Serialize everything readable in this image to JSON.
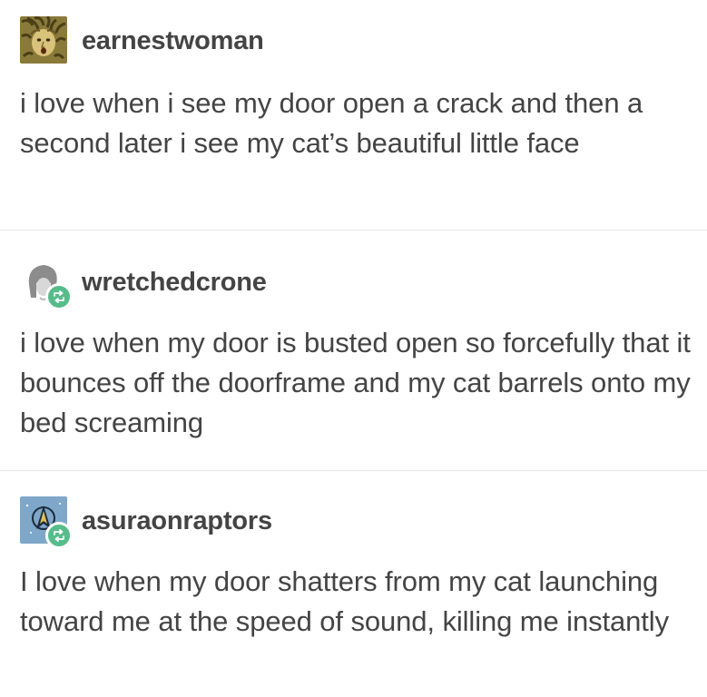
{
  "posts": [
    {
      "username": "earnestwoman",
      "avatar_icon": "medusa-avatar-icon",
      "reblog": false,
      "text": "i love when i see my door open a crack and then a second later i see my cat’s beautiful little face"
    },
    {
      "username": "wretchedcrone",
      "avatar_icon": "crone-avatar-icon",
      "reblog": true,
      "text": "i love when my door is busted open so forcefully that it bounces off the doorframe and my cat barrels onto my bed screaming"
    },
    {
      "username": "asuraonraptors",
      "avatar_icon": "starfleet-avatar-icon",
      "reblog": true,
      "text": "I love when my door shatters from my cat launching toward me at the speed of sound, killing me instantly"
    }
  ],
  "colors": {
    "text": "#444444",
    "reblog_badge": "#56bc8a",
    "divider": "#e8e8e8"
  }
}
